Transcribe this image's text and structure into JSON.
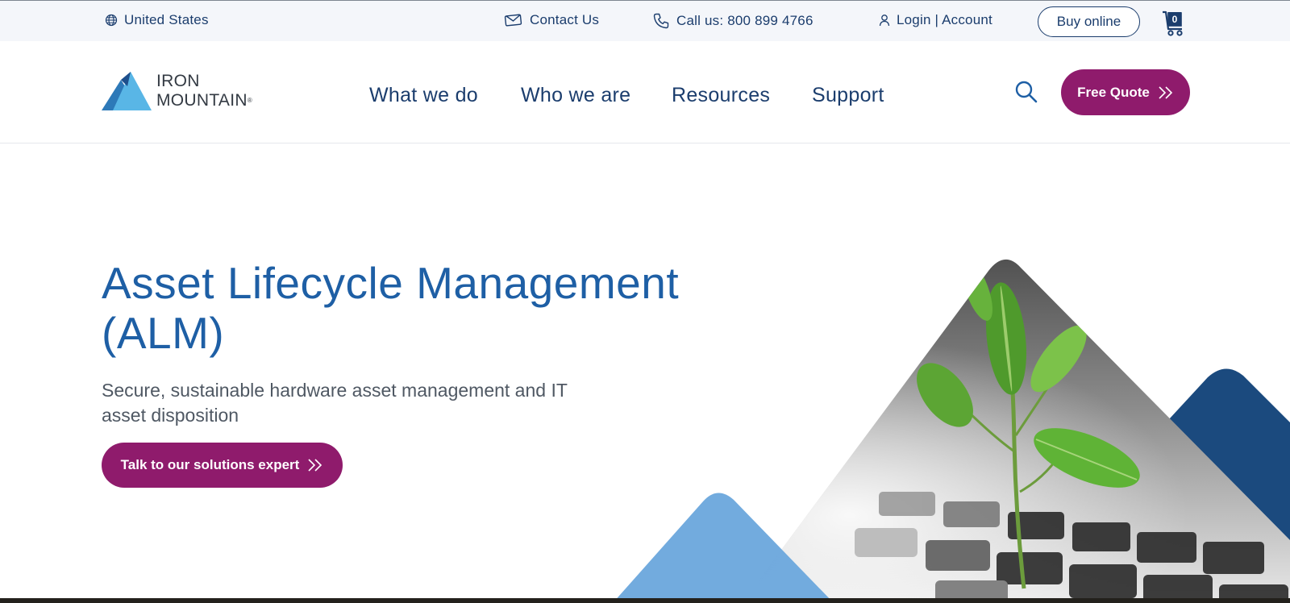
{
  "utility_bar": {
    "region": "United States",
    "contact": "Contact Us",
    "call": "Call us: 800 899 4766",
    "login": "Login | Account",
    "buy_online": "Buy online",
    "cart_count": "0"
  },
  "logo": {
    "line1": "IRON",
    "line2": "MOUNTAIN",
    "mark": "®"
  },
  "nav": {
    "items": [
      "What we do",
      "Who we are",
      "Resources",
      "Support"
    ],
    "free_quote": "Free Quote"
  },
  "hero": {
    "title": "Asset Lifecycle Management (ALM)",
    "subtitle": "Secure, sustainable hardware asset management and IT asset disposition",
    "cta": "Talk to our solutions expert"
  },
  "colors": {
    "navy": "#1b3d6d",
    "title_blue": "#1e5fa5",
    "magenta": "#8f1b6c",
    "light_blue": "#6aa6dc",
    "utility_bg": "#f4f6fa"
  },
  "icons": {
    "region": "globe-icon",
    "contact": "envelope-icon",
    "call": "phone-icon",
    "login": "user-icon",
    "cart": "cart-icon",
    "search": "search-icon",
    "chevrons": "double-chevron-right-icon"
  },
  "hero_image": {
    "subject": "plant-on-keyboard"
  }
}
